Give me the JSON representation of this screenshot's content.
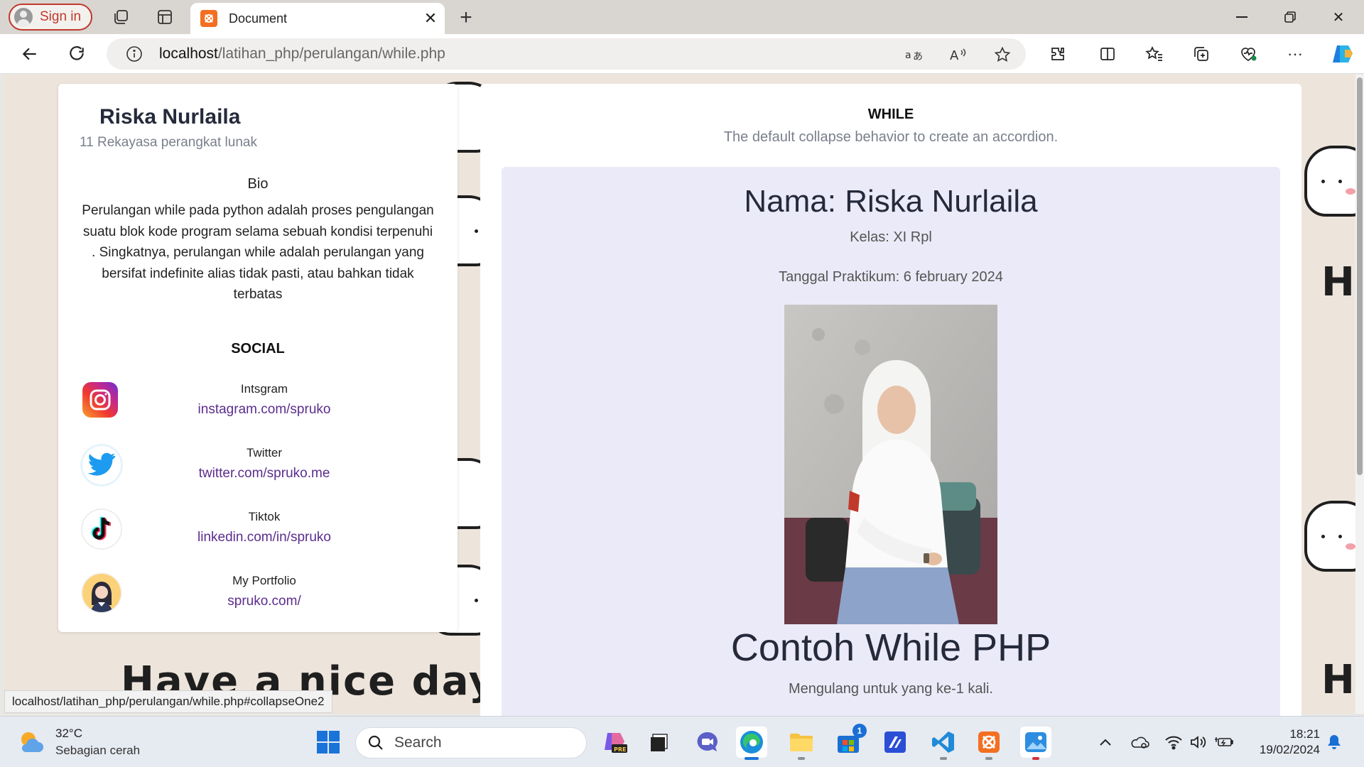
{
  "browser": {
    "signin_label": "Sign in",
    "tab_title": "Document",
    "url_host": "localhost",
    "url_path": "/latihan_php/perulangan/while.php",
    "status_url": "localhost/latihan_php/perulangan/while.php#collapseOne2"
  },
  "background": {
    "left_text": "Have a nice day!",
    "right_text": "Ha",
    "right_text_bottom": "Ha"
  },
  "profile": {
    "name": "Riska Nurlaila",
    "class": "11 Rekayasa perangkat lunak",
    "bio_title": "Bio",
    "bio": "Perulangan while pada python adalah proses pengulangan suatu blok kode program selama sebuah kondisi terpenuhi . Singkatnya, perulangan while adalah perulangan yang bersifat indefinite alias tidak pasti, atau bahkan tidak terbatas",
    "social_title": "SOCIAL",
    "socials": [
      {
        "label": "Intsgram",
        "link": "instagram.com/spruko",
        "icon": "instagram-icon"
      },
      {
        "label": "Twitter",
        "link": "twitter.com/spruko.me",
        "icon": "twitter-icon"
      },
      {
        "label": "Tiktok",
        "link": "linkedin.com/in/spruko",
        "icon": "tiktok-icon"
      },
      {
        "label": "My Portfolio",
        "link": "spruko.com/",
        "icon": "portfolio-avatar-icon"
      }
    ]
  },
  "main": {
    "title": "WHILE",
    "subtitle": "The default collapse behavior to create an accordion.",
    "name": "Nama: Riska Nurlaila",
    "kelas": "Kelas: XI Rpl",
    "tanggal": "Tanggal Praktikum: 6 february 2024",
    "heading": "Contoh While PHP",
    "repeat_text": "Mengulang untuk yang ke-1 kali."
  },
  "taskbar": {
    "weather_temp": "32°C",
    "weather_desc": "Sebagian cerah",
    "search_label": "Search",
    "store_badge": "1",
    "time": "18:21",
    "date": "19/02/2024"
  },
  "colors": {
    "accent_red": "#c0392b",
    "link_purple": "#5b2d8e",
    "card_tint": "#ebeaf8",
    "taskbar_blue": "#1a73d8"
  }
}
